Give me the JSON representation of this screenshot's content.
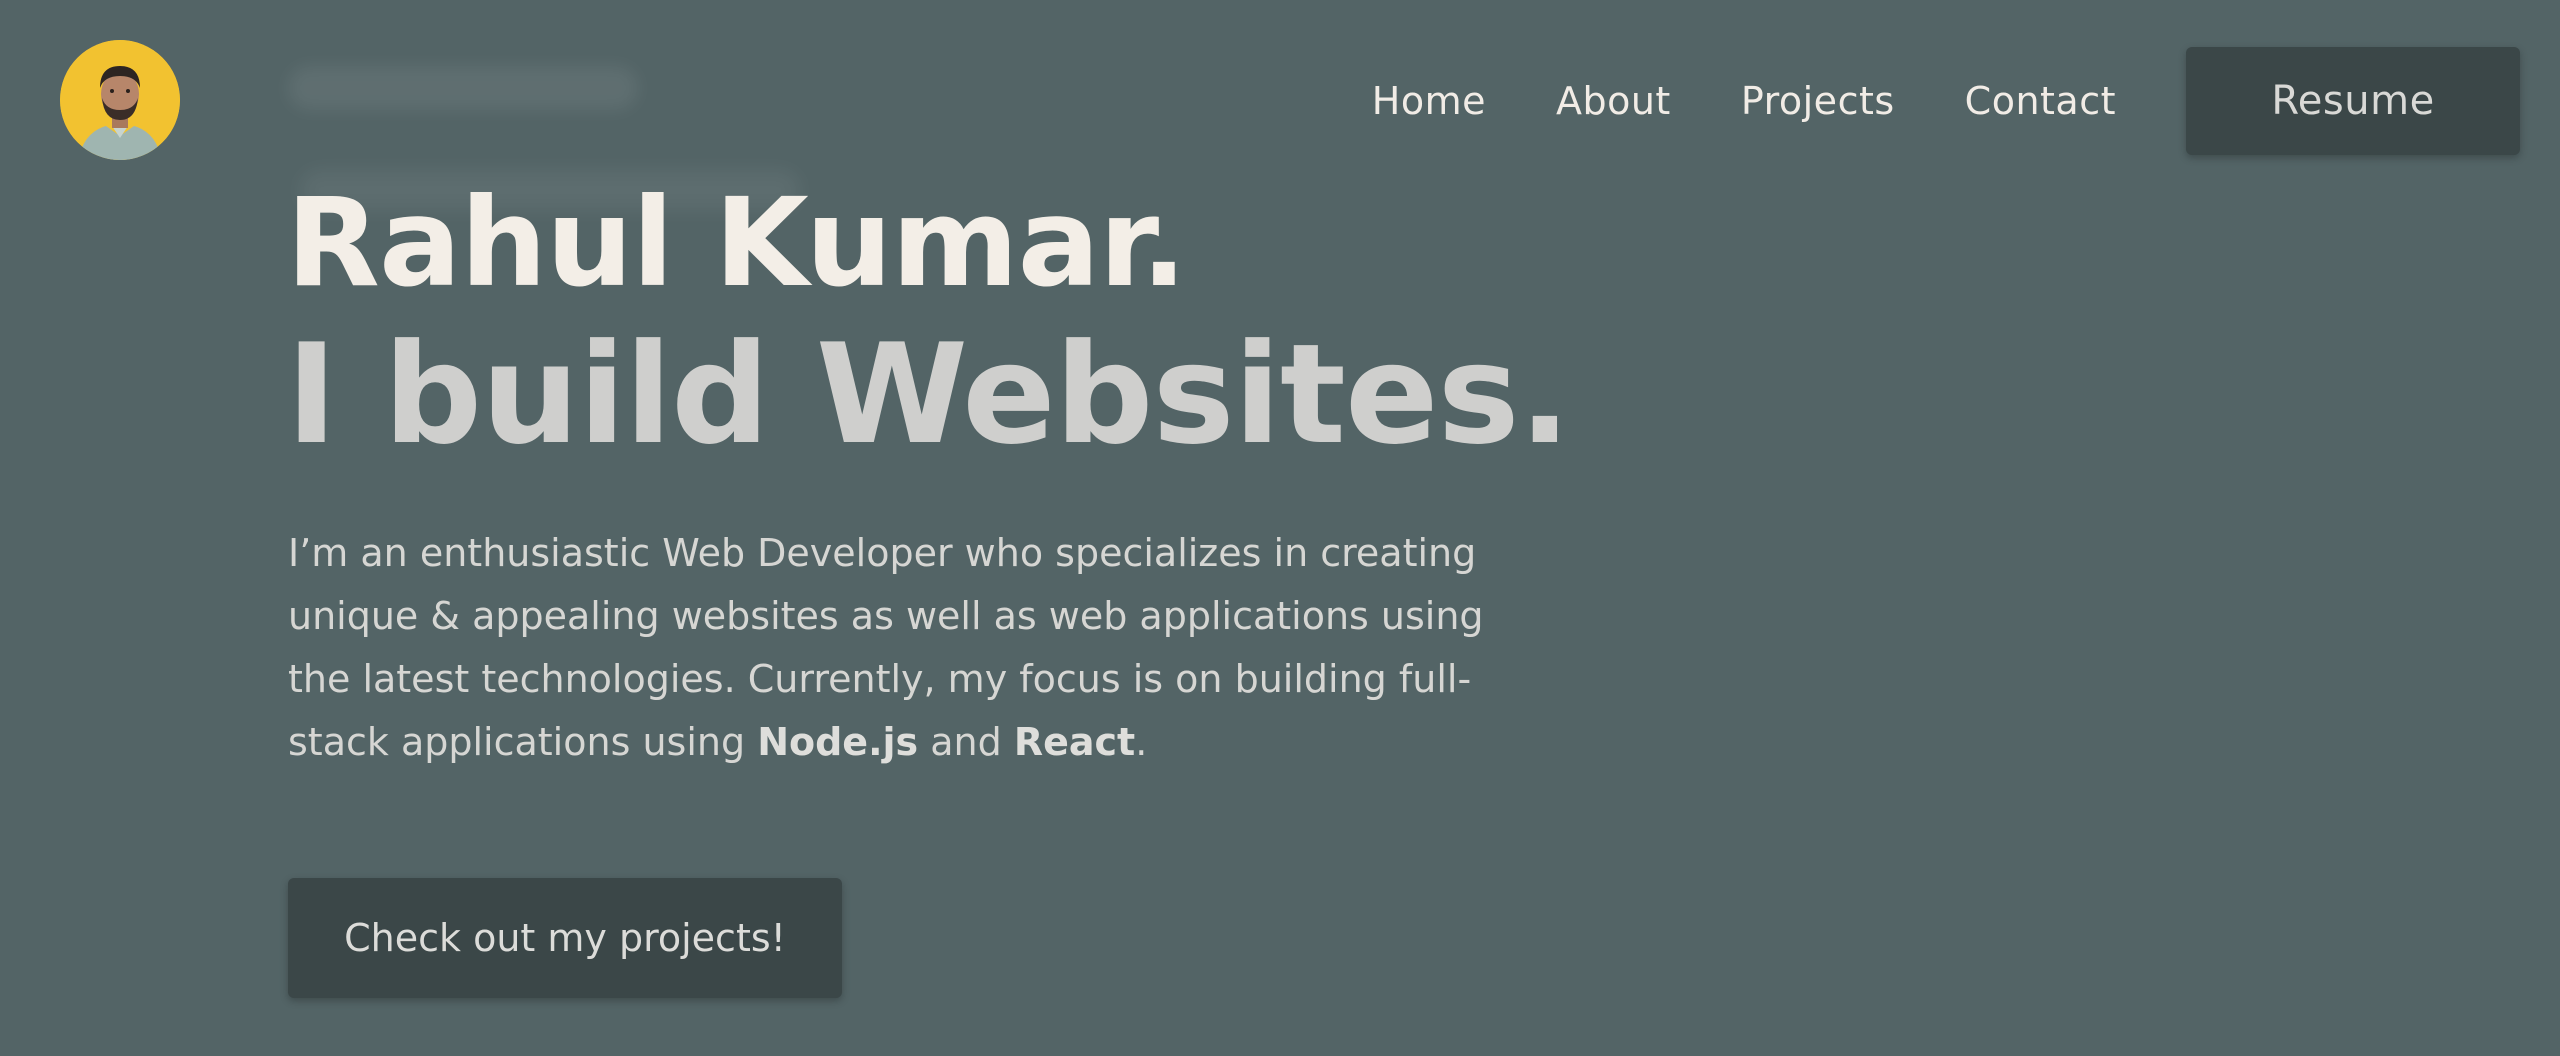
{
  "header": {
    "avatar_alt": "Profile photo",
    "nav": {
      "home": "Home",
      "about": "About",
      "projects": "Projects",
      "contact": "Contact"
    },
    "resume_label": "Resume"
  },
  "hero": {
    "name": "Rahul Kumar.",
    "tagline": "I build Websites.",
    "description": {
      "line1": "I’m an enthusiastic Web Developer who specializes in creating",
      "line2": "unique & appealing websites as well as web applications using",
      "line3": "the latest technologies. Currently, my focus is on building full-",
      "line4_prefix": "stack applications using ",
      "tech1": "Node.js",
      "conjunction": " and ",
      "tech2": "React",
      "line4_suffix": "."
    },
    "cta_label": "Check out my projects!"
  },
  "colors": {
    "background": "#536466",
    "button_bg": "#3b4748",
    "avatar_bg": "#f2c230",
    "heading_primary": "#f3eee7",
    "heading_secondary": "#cfcfcd"
  }
}
